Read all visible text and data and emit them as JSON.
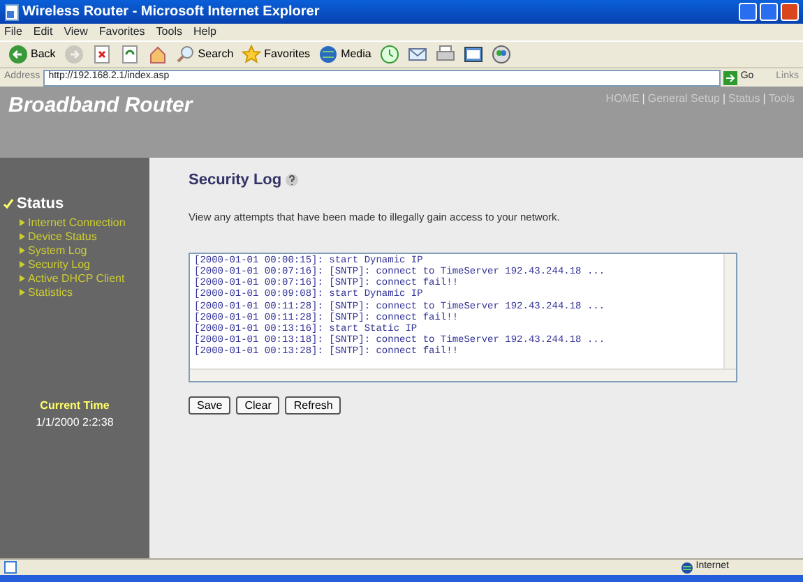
{
  "window": {
    "title": "Wireless Router - Microsoft Internet Explorer"
  },
  "menu": [
    "File",
    "Edit",
    "View",
    "Favorites",
    "Tools",
    "Help"
  ],
  "toolbar": [
    {
      "kind": "back",
      "label": "Back",
      "disabled": false
    },
    {
      "kind": "forward",
      "disabled": true
    },
    {
      "kind": "stop",
      "disabled": false
    },
    {
      "kind": "refresh",
      "disabled": false
    },
    {
      "kind": "home",
      "disabled": false
    },
    {
      "kind": "search",
      "label": "Search",
      "disabled": false
    },
    {
      "kind": "favorites",
      "label": "Favorites",
      "disabled": false
    },
    {
      "kind": "media",
      "label": "Media",
      "disabled": false
    },
    {
      "kind": "history",
      "disabled": false
    },
    {
      "kind": "mail",
      "disabled": false
    },
    {
      "kind": "print",
      "disabled": false
    },
    {
      "kind": "edit",
      "disabled": false
    },
    {
      "kind": "messenger",
      "disabled": false
    }
  ],
  "address": {
    "label": "Address",
    "value": "http://192.168.2.1/index.asp",
    "go": "Go",
    "links": "Links"
  },
  "header": {
    "brand": "Broadband Router",
    "nav": [
      {
        "kind": "link",
        "text": "HOME"
      },
      {
        "kind": "separator",
        "text": "|"
      },
      {
        "kind": "link",
        "text": "General Setup"
      },
      {
        "kind": "separator",
        "text": "|"
      },
      {
        "kind": "link",
        "text": "Status"
      },
      {
        "kind": "separator",
        "text": "|"
      },
      {
        "kind": "link",
        "text": "Tools"
      }
    ]
  },
  "sidebar": {
    "section": "Status",
    "expanded": true,
    "items": [
      "Internet Connection",
      "Device Status",
      "System Log",
      "Security Log",
      "Active DHCP Client",
      "Statistics"
    ],
    "time_label": "Current Time",
    "time_value": "1/1/2000 2:2:38"
  },
  "content": {
    "title": "Security Log",
    "description": "View any attempts that have been made to illegally gain access to your network.",
    "log": [
      "[2000-01-01 00:00:15]: start Dynamic IP",
      "[2000-01-01 00:07:16]: [SNTP]: connect to TimeServer 192.43.244.18 ...",
      "[2000-01-01 00:07:16]: [SNTP]: connect fail!!",
      "[2000-01-01 00:09:08]: start Dynamic IP",
      "[2000-01-01 00:11:28]: [SNTP]: connect to TimeServer 192.43.244.18 ...",
      "[2000-01-01 00:11:28]: [SNTP]: connect fail!!",
      "[2000-01-01 00:13:16]: start Static IP",
      "[2000-01-01 00:13:18]: [SNTP]: connect to TimeServer 192.43.244.18 ...",
      "[2000-01-01 00:13:28]: [SNTP]: connect fail!!"
    ],
    "buttons": [
      "Save",
      "Clear",
      "Refresh"
    ]
  },
  "status_bar": {
    "zone": "Internet"
  }
}
